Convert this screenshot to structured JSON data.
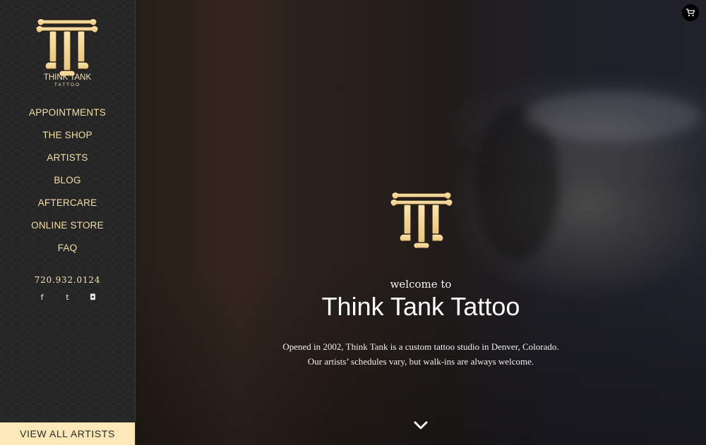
{
  "sidebar": {
    "brand": {
      "line1": "THINK TANK",
      "line2": "TATTOO"
    },
    "nav": [
      {
        "label": "APPOINTMENTS"
      },
      {
        "label": "THE SHOP"
      },
      {
        "label": "ARTISTS"
      },
      {
        "label": "BLOG"
      },
      {
        "label": "AFTERCARE"
      },
      {
        "label": "ONLINE STORE"
      },
      {
        "label": "FAQ"
      }
    ],
    "phone": "720.932.0124",
    "social": [
      {
        "icon": "facebook-icon",
        "glyph": "f"
      },
      {
        "icon": "twitter-icon",
        "glyph": "t"
      },
      {
        "icon": "instagram-icon",
        "glyph": "◘"
      }
    ],
    "view_all_label": "VIEW ALL ARTISTS"
  },
  "hero": {
    "welcome": "welcome to",
    "title": "Think Tank Tattoo",
    "description": "Opened in 2002, Think Tank is a custom tattoo studio in Denver, Colorado. Our artists’ schedules vary, but walk-ins are always welcome."
  },
  "icons": {
    "cart": "cart-icon",
    "scroll_down": "chevron-down-icon"
  },
  "colors": {
    "accent": "#f6dfa8",
    "button_bg": "#fbe8b9",
    "sidebar_bg": "#252525"
  }
}
